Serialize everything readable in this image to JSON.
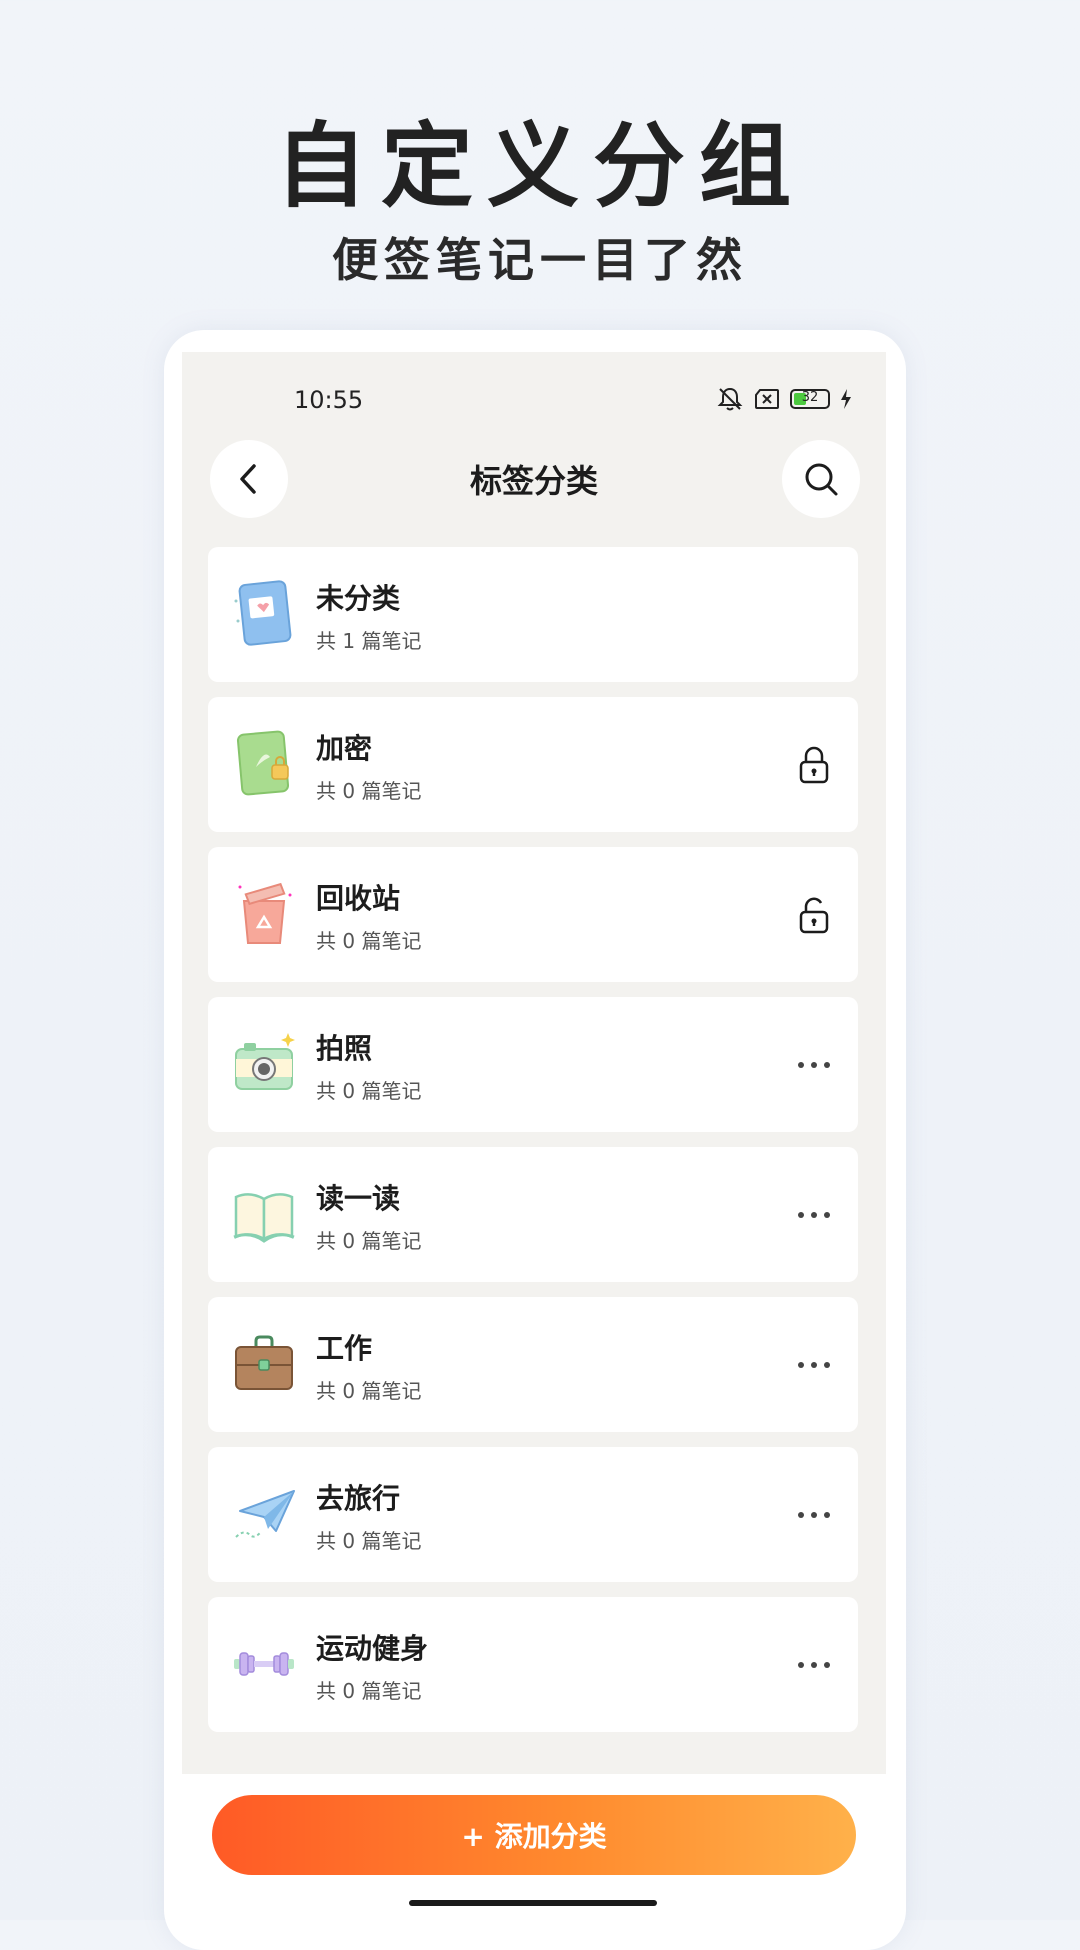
{
  "promo": {
    "title": "自定义分组",
    "subtitle": "便签笔记一目了然"
  },
  "status_bar": {
    "time": "10:55",
    "battery": "32",
    "icons": [
      "mute-icon",
      "sim-off-icon",
      "battery-icon",
      "charging-icon"
    ]
  },
  "header": {
    "title": "标签分类",
    "back_icon": "chevron-left-icon",
    "search_icon": "search-icon"
  },
  "categories": [
    {
      "name": "未分类",
      "count": "共 1 篇笔记",
      "icon": "blue-notebook-icon",
      "action": "none"
    },
    {
      "name": "加密",
      "count": "共 0 篇笔记",
      "icon": "green-notebook-lock-icon",
      "action": "lock-icon"
    },
    {
      "name": "回收站",
      "count": "共 0 篇笔记",
      "icon": "recycle-bin-icon",
      "action": "unlock-icon"
    },
    {
      "name": "拍照",
      "count": "共 0 篇笔记",
      "icon": "camera-icon",
      "action": "more-icon"
    },
    {
      "name": "读一读",
      "count": "共 0 篇笔记",
      "icon": "open-book-icon",
      "action": "more-icon"
    },
    {
      "name": "工作",
      "count": "共 0 篇笔记",
      "icon": "briefcase-icon",
      "action": "more-icon"
    },
    {
      "name": "去旅行",
      "count": "共 0 篇笔记",
      "icon": "paper-plane-icon",
      "action": "more-icon"
    },
    {
      "name": "运动健身",
      "count": "共 0 篇笔记",
      "icon": "dumbbell-icon",
      "action": "more-icon"
    }
  ],
  "footer": {
    "add_label": "+ 添加分类"
  },
  "colors": {
    "accent_start": "#ff5a26",
    "accent_end": "#ffb14a",
    "screen_bg": "#f3f2ef",
    "card_bg": "#ffffff"
  }
}
